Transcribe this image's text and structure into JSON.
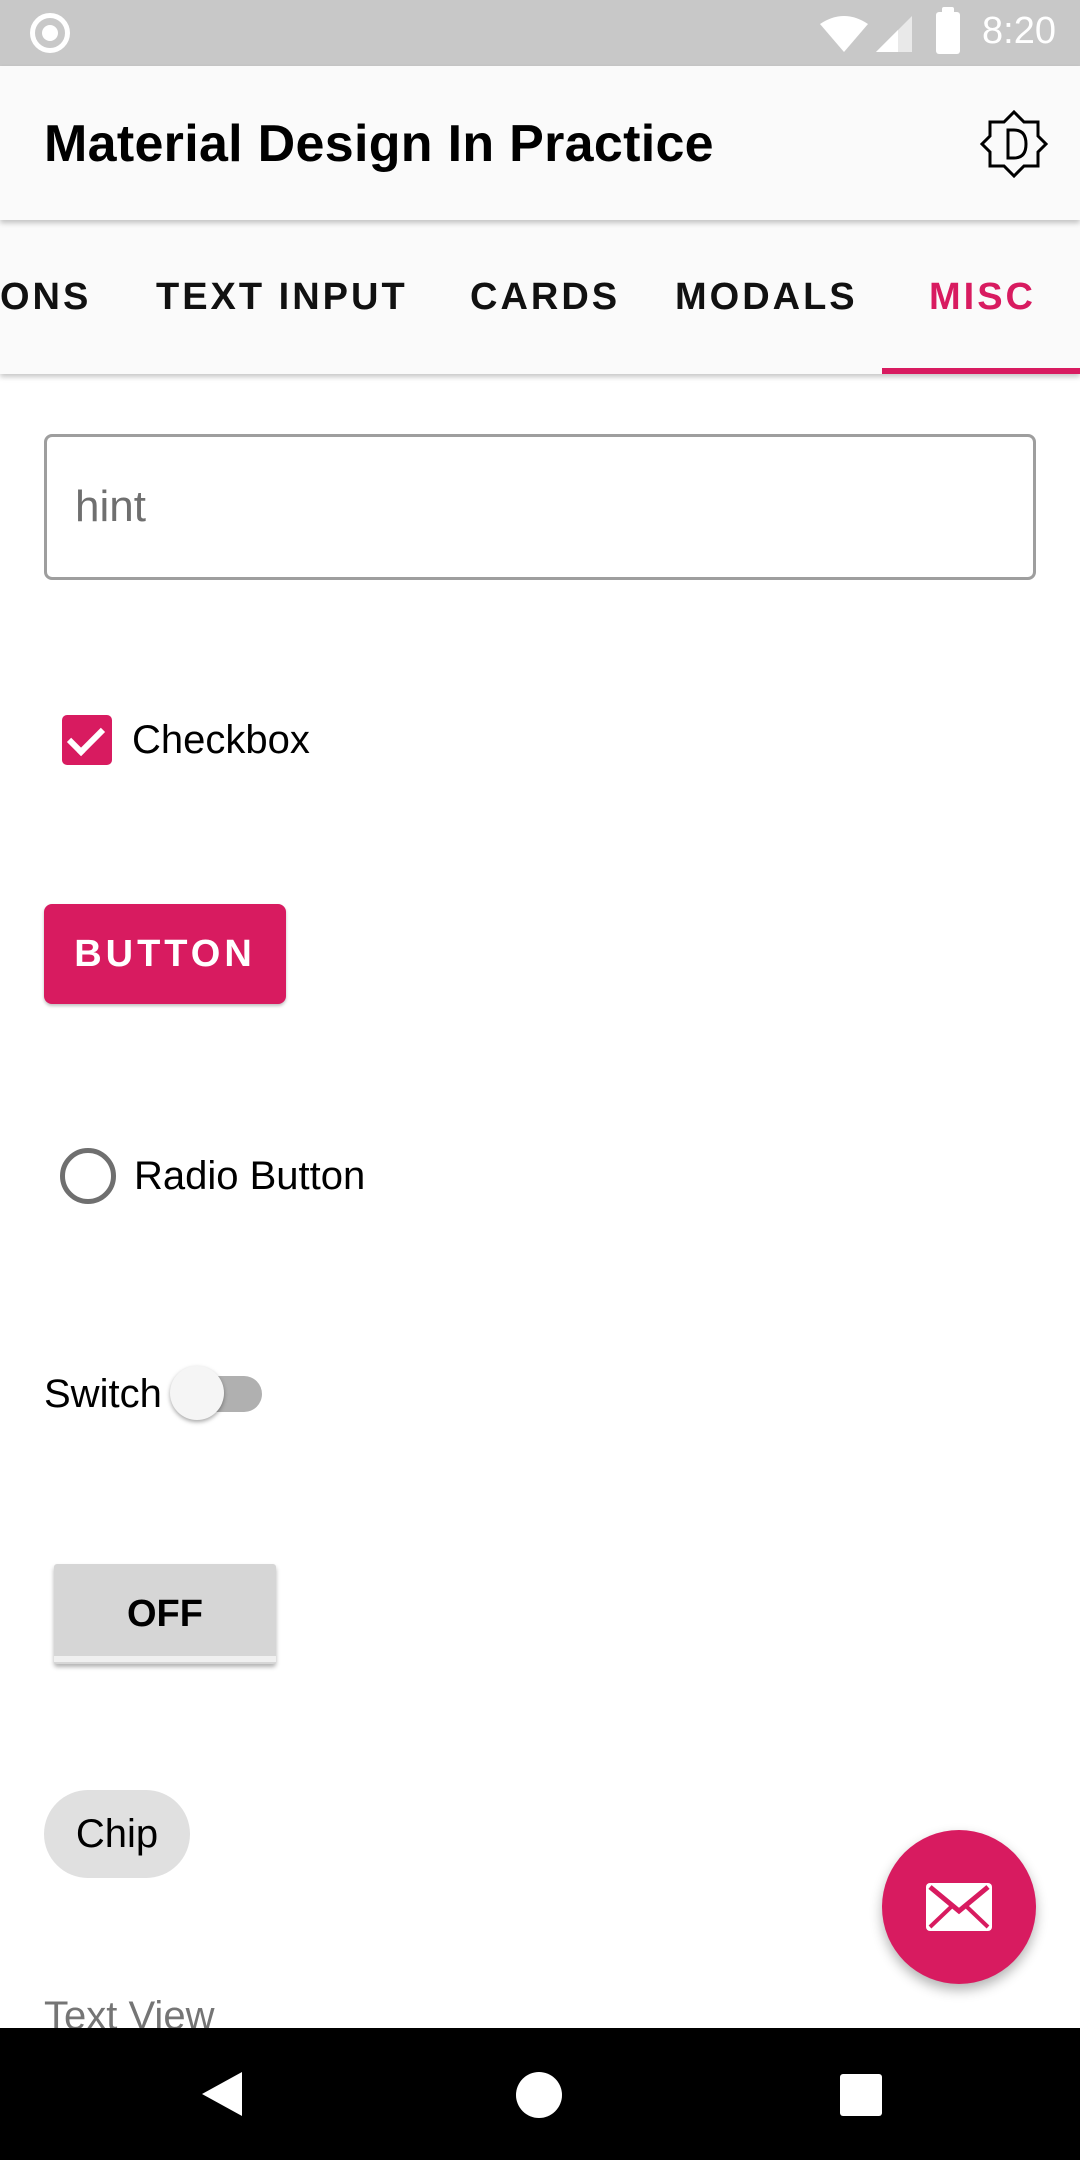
{
  "status_bar": {
    "time": "8:20",
    "icons": [
      "notification-circle-icon",
      "wifi-icon",
      "signal-icon",
      "battery-icon"
    ]
  },
  "app_bar": {
    "title": "Material Design In Practice",
    "theme_icon": "brightness-auto-icon"
  },
  "tabs": {
    "items": [
      {
        "label": "ONS"
      },
      {
        "label": "TEXT INPUT"
      },
      {
        "label": "CARDS"
      },
      {
        "label": "MODALS"
      },
      {
        "label": "MISC"
      }
    ],
    "active": "MISC"
  },
  "content": {
    "text_field": {
      "placeholder": "hint",
      "value": ""
    },
    "checkbox": {
      "label": "Checkbox",
      "checked": true
    },
    "button": {
      "label": "BUTTON"
    },
    "radio": {
      "label": "Radio Button",
      "selected": false
    },
    "switch": {
      "label": "Switch",
      "on": false
    },
    "toggle_button": {
      "label": "OFF",
      "on": false
    },
    "chip": {
      "label": "Chip"
    },
    "text_view": {
      "text": "Text View"
    }
  },
  "fab": {
    "icon": "email-icon"
  },
  "nav_bar": {
    "icons": [
      "back-icon",
      "home-icon",
      "recents-icon"
    ]
  },
  "colors": {
    "accent": "#d81b60",
    "status_bar": "#c8c8c8",
    "app_bar": "#fafafa",
    "nav_bar": "#000000"
  }
}
